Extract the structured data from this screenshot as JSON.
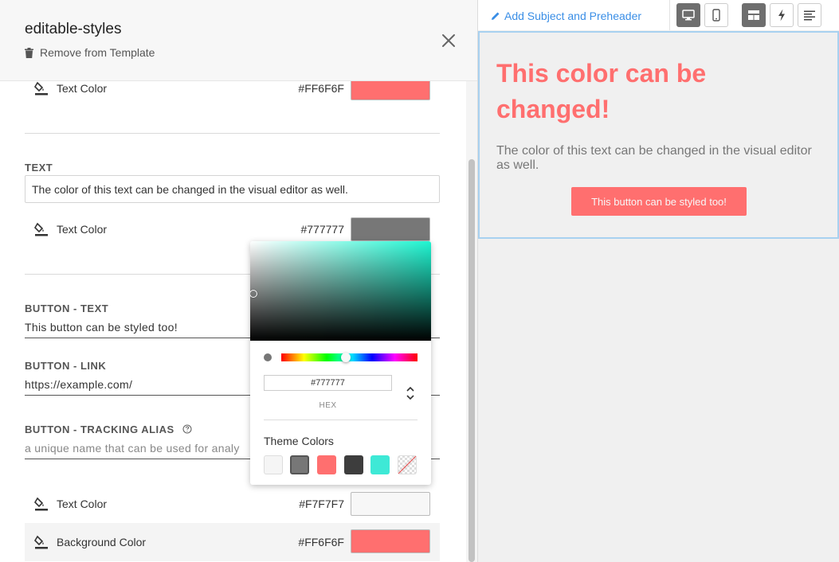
{
  "panel": {
    "title": "editable-styles",
    "remove_label": "Remove from Template",
    "close_icon": "close-icon"
  },
  "heading_section": {
    "text_color_label": "Text Color",
    "text_color_hex": "#FF6F6F",
    "text_color_value": "#ff6f6f"
  },
  "text_section": {
    "label": "TEXT",
    "value": "The color of this text can be changed in the visual editor as well.",
    "text_color_label": "Text Color",
    "text_color_hex": "#777777",
    "text_color_value": "#777777"
  },
  "button_section": {
    "text_label": "BUTTON - TEXT",
    "text_value": "This button can be styled too!",
    "link_label": "BUTTON - LINK",
    "link_value": "https://example.com/",
    "alias_label": "BUTTON - TRACKING ALIAS",
    "alias_placeholder": "a unique name that can be used for analy",
    "text_color_label": "Text Color",
    "text_color_hex": "#F7F7F7",
    "text_color_value": "#f7f7f7",
    "bg_color_label": "Background Color",
    "bg_color_hex": "#FF6F6F",
    "bg_color_value": "#ff6f6f"
  },
  "color_picker": {
    "hex_value": "#777777",
    "mode_label": "HEX",
    "theme_title": "Theme Colors",
    "theme_colors": [
      "#f5f5f5",
      "#777777",
      "#ff6f6f",
      "#3d3d3d",
      "#3ee9d6",
      "transparent"
    ]
  },
  "toolbar": {
    "add_subject_label": "Add Subject and Preheader",
    "accent": "#3a8ee6"
  },
  "preview": {
    "heading": "This color can be changed!",
    "body": "The color of this text can be changed in the visual editor as well.",
    "button_text": "This button can be styled too!"
  }
}
